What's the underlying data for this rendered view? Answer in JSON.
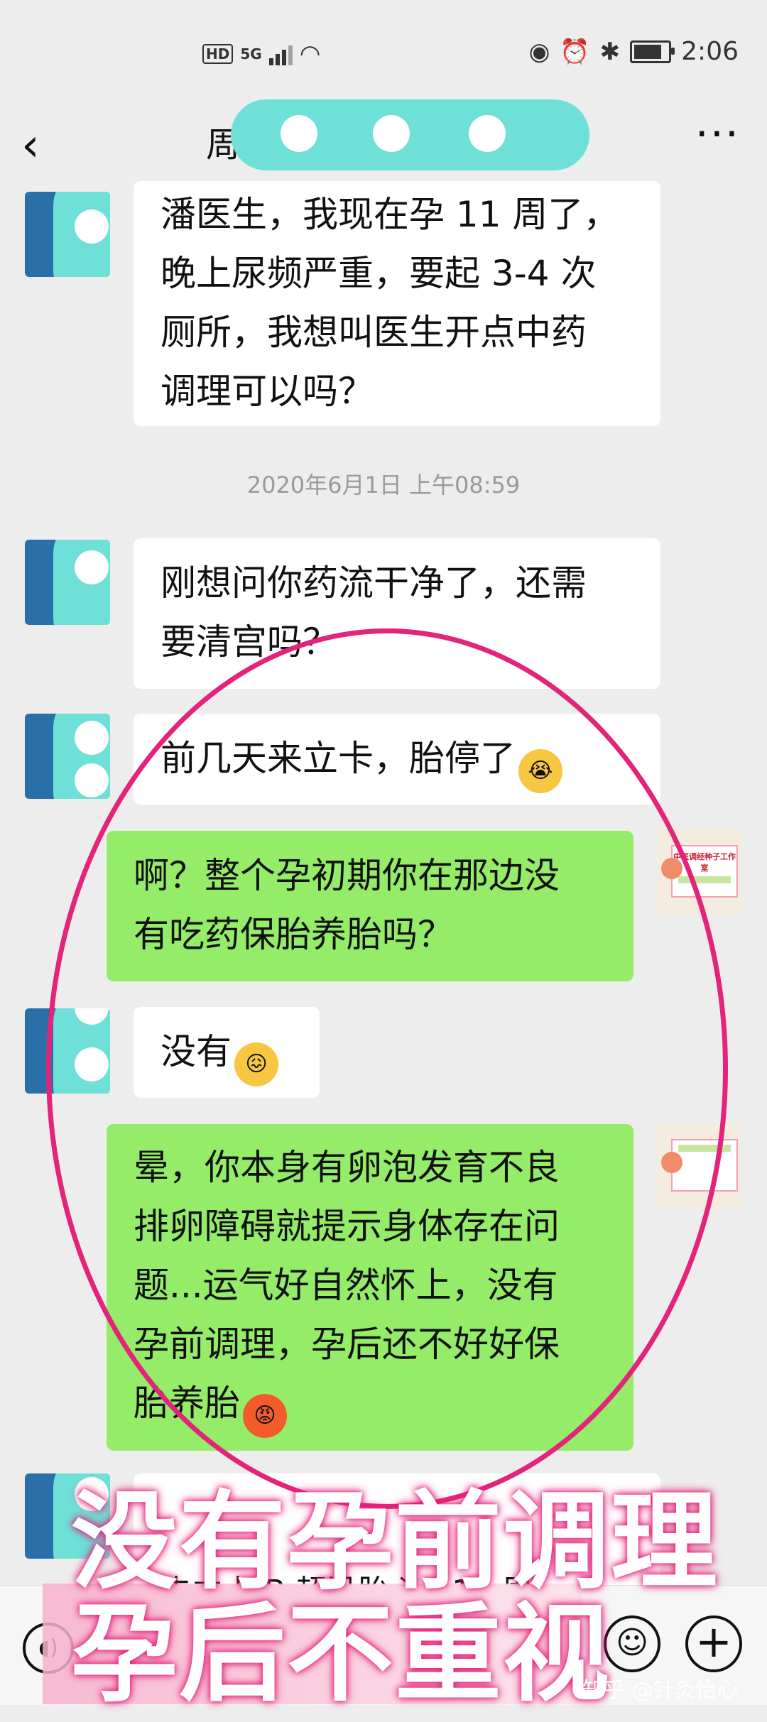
{
  "status_bar": {
    "hd": "HD",
    "network": "5G",
    "time": "2:06"
  },
  "header": {
    "title_visible": "周",
    "back_icon": "chevron-left-icon",
    "more_icon": "more-dots-icon"
  },
  "messages": [
    {
      "side": "left",
      "text_lines": [
        "潘医生，我现在孕 11 周了，",
        "晚上尿频严重，要起 3-4 次",
        "厕所，我想叫医生开点中药",
        "调理可以吗？"
      ]
    },
    {
      "timestamp": "2020年6月1日 上午08:59"
    },
    {
      "side": "left",
      "text_lines": [
        "刚想问你药流干净了，还需",
        "要清宫吗？"
      ]
    },
    {
      "side": "left",
      "text_lines": [
        "前几天来立卡，胎停了"
      ],
      "emoji": "crying-emoji"
    },
    {
      "side": "right",
      "text_lines": [
        "啊？整个孕初期你在那边没",
        "有吃药保胎养胎吗？"
      ]
    },
    {
      "side": "left",
      "text_lines": [
        "没有"
      ],
      "emoji": "frown-emoji"
    },
    {
      "side": "right",
      "text_lines": [
        "晕，你本身有卵泡发育不良",
        "排卵障碍就提示身体存在问",
        "题...运气好自然怀上，没有",
        "孕前调理，孕后还不好好保",
        "胎养胎"
      ],
      "emoji": "angry-emoji"
    },
    {
      "side": "left",
      "text_lines": [
        "去立卡 B 超没胎心，10 周"
      ]
    }
  ],
  "right_avatar": {
    "text": "中医调经种子工作室"
  },
  "overlay": {
    "line1": "没有孕前调理",
    "line2": "孕后不重视"
  },
  "watermark": "知乎 @针灸怡心",
  "colors": {
    "accent_pink": "#e4237a",
    "bubble_green": "#95ec69",
    "mask_teal": "#6ee0d8"
  }
}
